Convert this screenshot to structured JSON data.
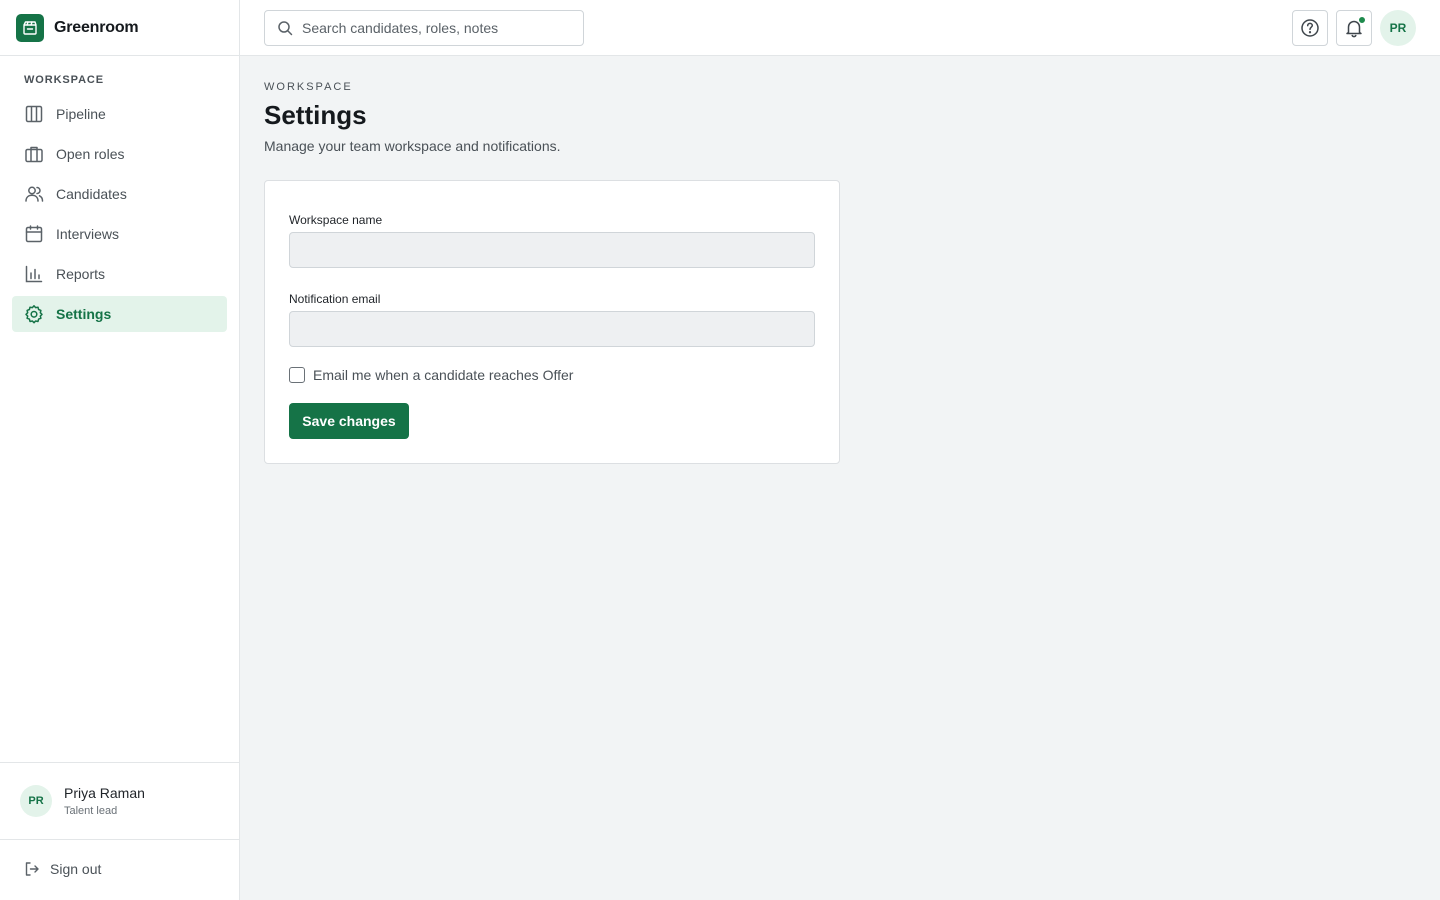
{
  "app": {
    "name": "Greenroom"
  },
  "sidebar": {
    "section_label": "WORKSPACE",
    "items": [
      {
        "label": "Pipeline",
        "icon": "pipeline-icon",
        "active": false
      },
      {
        "label": "Open roles",
        "icon": "briefcase-icon",
        "active": false
      },
      {
        "label": "Candidates",
        "icon": "users-icon",
        "active": false
      },
      {
        "label": "Interviews",
        "icon": "calendar-icon",
        "active": false
      },
      {
        "label": "Reports",
        "icon": "bar-chart-icon",
        "active": false
      },
      {
        "label": "Settings",
        "icon": "gear-icon",
        "active": true
      }
    ],
    "user": {
      "initials": "PR",
      "name": "Priya Raman",
      "role": "Talent lead"
    },
    "sign_out": "Sign out"
  },
  "topbar": {
    "search_placeholder": "Search candidates, roles, notes",
    "avatar_initials": "PR",
    "has_notification": true
  },
  "page": {
    "eyebrow": "WORKSPACE",
    "title": "Settings",
    "subtitle": "Manage your team workspace and notifications."
  },
  "form": {
    "workspace_name_label": "Workspace name",
    "workspace_name_value": "",
    "notification_email_label": "Notification email",
    "notification_email_value": "",
    "offer_checkbox_label": "Email me when a candidate reaches Offer",
    "offer_checkbox_checked": false,
    "save_label": "Save changes"
  },
  "colors": {
    "brand": "#157347",
    "active_bg": "#e3f3ea",
    "page_bg": "#f2f4f5"
  }
}
